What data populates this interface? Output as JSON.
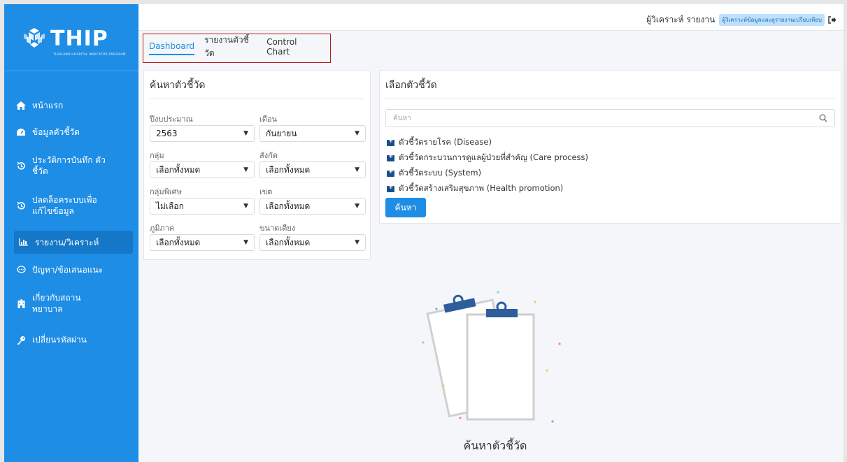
{
  "brand": {
    "title": "THIP",
    "subtitle": "THAILAND HOSPITAL INDICATOR PROGRAM"
  },
  "sidebar": {
    "items": [
      {
        "label": "หน้าแรก",
        "icon": "home-icon"
      },
      {
        "label": "ข้อมูลตัวชี้วัด",
        "icon": "dashboard-icon"
      },
      {
        "label": "ประวัติการบันทึก ตัวชี้วัด",
        "icon": "history-icon"
      },
      {
        "label": "ปลดล็อคระบบเพื่อ แก้ไขข้อมูล",
        "icon": "unlock-history-icon"
      },
      {
        "label": "รายงาน/วิเคราะห์",
        "icon": "chart-icon",
        "active": true
      },
      {
        "label": "ปัญหา/ข้อเสนอแนะ",
        "icon": "comment-icon"
      },
      {
        "label": "เกี่ยวกับสถาน พยาบาล",
        "icon": "hospital-icon"
      },
      {
        "label": "เปลี่ยนรหัสผ่าน",
        "icon": "key-icon"
      }
    ]
  },
  "topbar": {
    "user_label": "ผู้วิเคราะห์ รายงาน",
    "role_badge": "ผู้วิเคราะห์ข้อมูลและดูรายงานเปรียบเทียบ",
    "logout_icon": "sign-out-icon"
  },
  "tabs": [
    {
      "label": "Dashboard",
      "active": true
    },
    {
      "label": "รายงานตัวชี้วัด",
      "active": false
    },
    {
      "label": "Control Chart",
      "active": false
    }
  ],
  "search_panel": {
    "title": "ค้นหาตัวชี้วัด",
    "fields": {
      "fiscal_year": {
        "label": "ปีงบประมาณ",
        "value": "2563"
      },
      "month": {
        "label": "เดือน",
        "value": "กันยายน"
      },
      "group": {
        "label": "กลุ่ม",
        "value": "เลือกทั้งหมด"
      },
      "affiliation": {
        "label": "สังกัด",
        "value": "เลือกทั้งหมด"
      },
      "special_group": {
        "label": "กลุ่มพิเศษ",
        "value": "ไม่เลือก"
      },
      "zone": {
        "label": "เขต",
        "value": "เลือกทั้งหมด"
      },
      "region": {
        "label": "ภูมิภาค",
        "value": "เลือกทั้งหมด"
      },
      "bed_size": {
        "label": "ขนาดเตียง",
        "value": "เลือกทั้งหมด"
      }
    }
  },
  "indicator_panel": {
    "title": "เลือกตัวชี้วัด",
    "search_placeholder": "ค้นหา",
    "tree": [
      "ตัวชี้วัดรายโรค (Disease)",
      "ตัวชี้วัดกระบวนการดูแลผู้ป่วยที่สำคัญ (Care process)",
      "ตัวชี้วัดระบบ (System)",
      "ตัวชี้วัดสร้างเสริมสุขภาพ (Health promotion)"
    ],
    "search_button": "ค้นหา"
  },
  "empty_state": {
    "caption": "ค้นหาตัวชี้วัด"
  },
  "colors": {
    "primary": "#1e8de6",
    "sidebar_active": "#1577c8",
    "tab_outline": "#b9191e"
  }
}
